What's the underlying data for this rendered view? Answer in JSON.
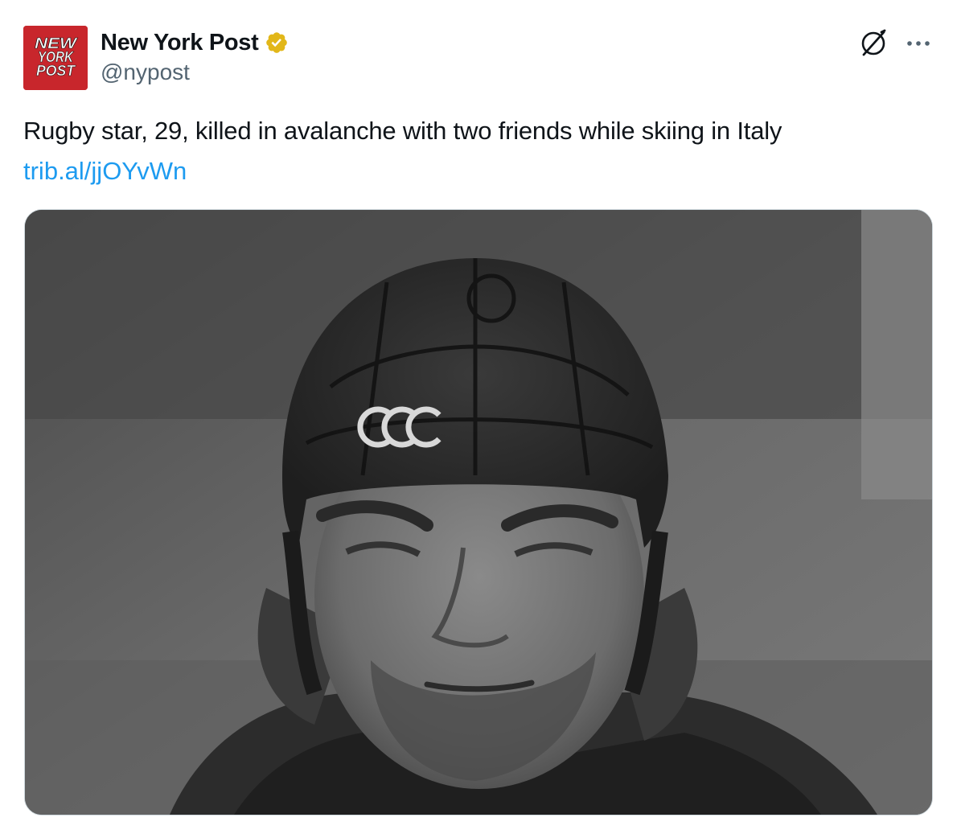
{
  "account": {
    "display_name": "New York Post",
    "handle": "@nypost",
    "verified_badge": "verified-gold-badge",
    "avatar_logo": "NEW YORK POST",
    "avatar_color": "#c8262c"
  },
  "actions": {
    "grok_icon": "grok-icon",
    "more_icon": "more-icon"
  },
  "tweet": {
    "text": "Rugby star, 29, killed in avalanche with two friends while skiing in Italy",
    "link": "trib.al/jjOYvWn",
    "link_color": "#1d9bf0"
  },
  "media": {
    "type": "photo",
    "description_icon": "photo-image"
  }
}
